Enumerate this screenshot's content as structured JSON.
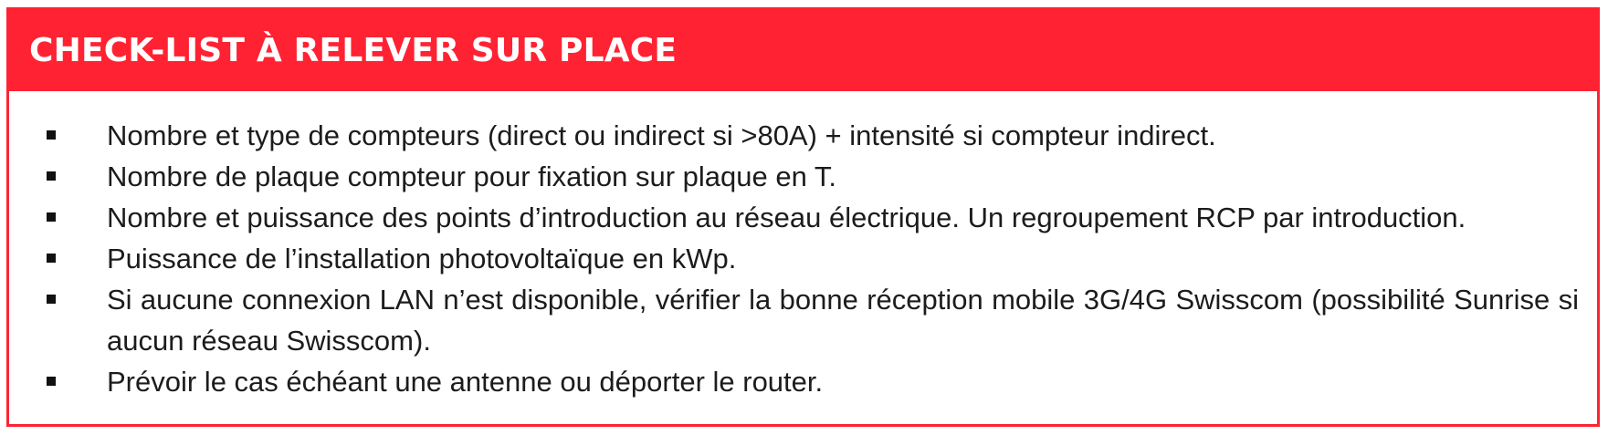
{
  "header": {
    "title": "CHECK-LIST À RELEVER SUR PLACE"
  },
  "checklist": {
    "items": [
      "Nombre et type de compteurs (direct ou indirect si >80A) + intensité si compteur indirect.",
      "Nombre de plaque compteur pour fixation sur plaque en T.",
      "Nombre et puissance des points d’introduction au réseau électrique. Un regroupement RCP par introduction.",
      "Puissance de l’installation photovoltaïque en kWp.",
      "Si aucune connexion LAN n’est disponible, vérifier la bonne réception mobile 3G/4G Swisscom (possibilité Sunrise si aucun réseau Swisscom).",
      "Prévoir le cas échéant une antenne ou déporter le router."
    ]
  },
  "colors": {
    "accent": "#ff2232",
    "header_text": "#ffffff",
    "body_text": "#1c1c1c"
  }
}
